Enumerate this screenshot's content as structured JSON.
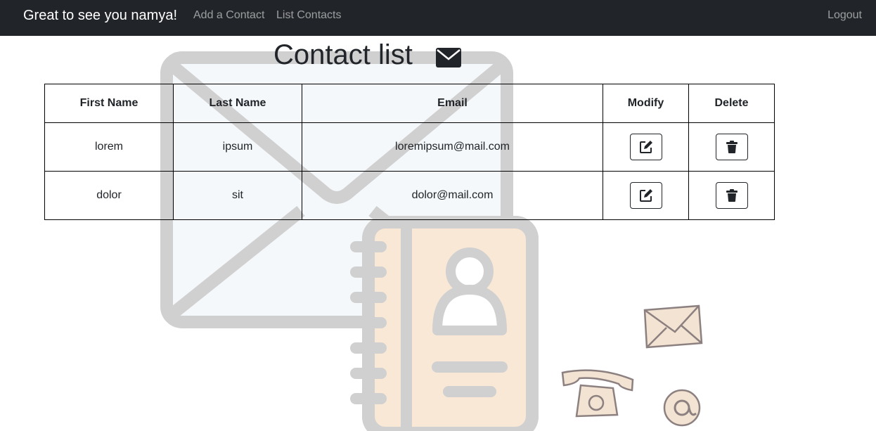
{
  "navbar": {
    "brand": "Great to see you namya!",
    "links": [
      "Add a Contact",
      "List Contacts"
    ],
    "logout": "Logout"
  },
  "page": {
    "title": "Contact list",
    "title_icon": "envelope-icon"
  },
  "table": {
    "headers": [
      "First Name",
      "Last Name",
      "Email",
      "Modify",
      "Delete"
    ],
    "rows": [
      {
        "first": "lorem",
        "last": "ipsum",
        "email": "loremipsum@mail.com"
      },
      {
        "first": "dolor",
        "last": "sit",
        "email": "dolor@mail.com"
      }
    ],
    "modify_icon": "edit-icon",
    "delete_icon": "trash-icon"
  },
  "colors": {
    "navbar_bg": "#212529",
    "background_art_stroke": "#cccccc",
    "background_art_fill": "#f9e8d6"
  }
}
